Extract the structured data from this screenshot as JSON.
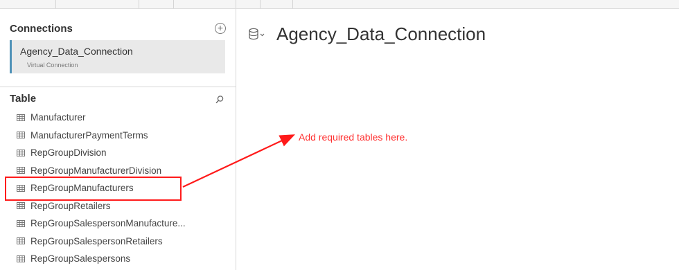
{
  "connections": {
    "title": "Connections",
    "items": [
      {
        "name": "Agency_Data_Connection",
        "type": "Virtual Connection"
      }
    ]
  },
  "tables": {
    "title": "Table",
    "items": [
      {
        "label": "Manufacturer"
      },
      {
        "label": "ManufacturerPaymentTerms"
      },
      {
        "label": "RepGroupDivision"
      },
      {
        "label": "RepGroupManufacturerDivision"
      },
      {
        "label": "RepGroupManufacturers"
      },
      {
        "label": "RepGroupRetailers"
      },
      {
        "label": "RepGroupSalespersonManufacture..."
      },
      {
        "label": "RepGroupSalespersonRetailers"
      },
      {
        "label": "RepGroupSalespersons"
      }
    ]
  },
  "main": {
    "title": "Agency_Data_Connection",
    "annotation": "Add required tables here."
  },
  "colors": {
    "accent": "#4f92b8",
    "annotation": "#ff1a1a"
  },
  "icons": {
    "add": "add-circle-icon",
    "search": "search-icon",
    "table": "table-grid-icon",
    "database": "database-icon"
  }
}
